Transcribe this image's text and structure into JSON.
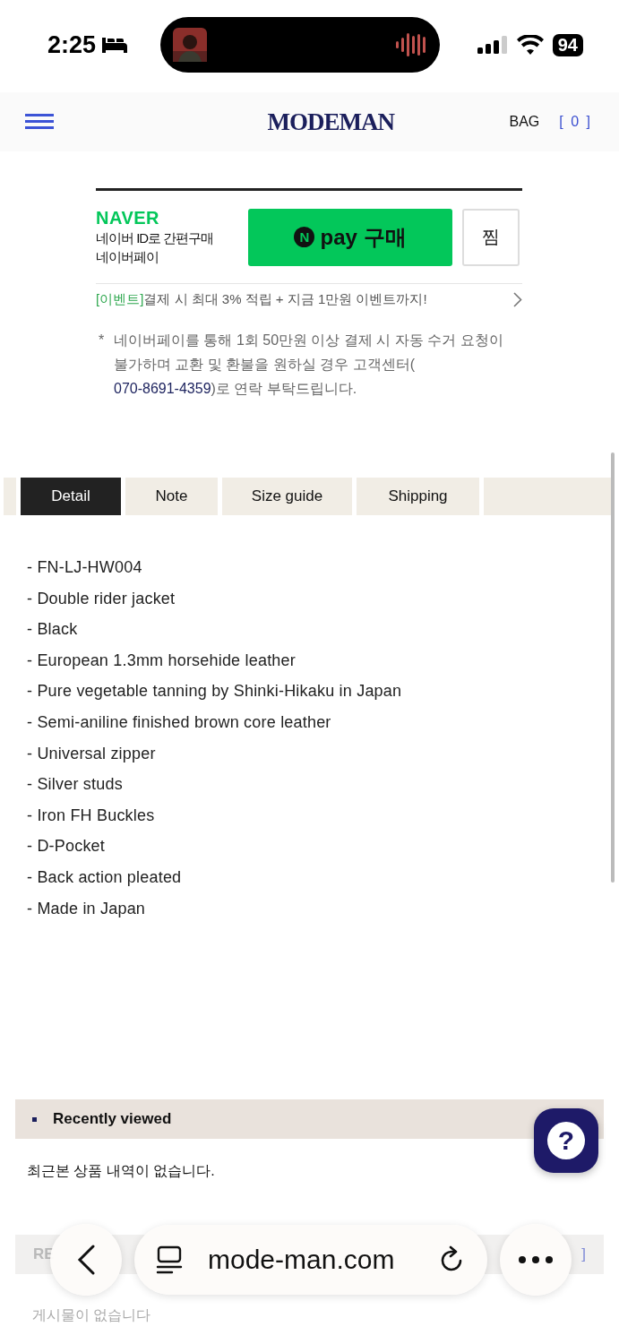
{
  "status_bar": {
    "time": "2:25",
    "battery": "94"
  },
  "header": {
    "logo": "MODEMAN",
    "bag_label": "BAG",
    "bag_count": "[ 0 ]"
  },
  "naver_pay": {
    "brand": "NAVER",
    "tagline": "네이버 ID로 간편구매",
    "subtitle": "네이버페이",
    "pay_badge": "N",
    "pay_button": "pay 구매",
    "wish_button": "찜",
    "event_tag": "[이벤트]",
    "event_text": "결제 시 최대 3% 적립 + 지금 1만원 이벤트까지!",
    "note_mark": "*",
    "note_text": "네이버페이를 통해 1회 50만원 이상 결제 시 자동 수거 요청이 불가하며 교환 및 환불을 원하실 경우 고객센터(",
    "note_phone": "070-8691-4359",
    "note_end": ")로 연락 부탁드립니다."
  },
  "tabs": [
    {
      "label": "Detail",
      "selected": true
    },
    {
      "label": "Note",
      "selected": false
    },
    {
      "label": "Size guide",
      "selected": false
    },
    {
      "label": "Shipping",
      "selected": false
    }
  ],
  "details": [
    "- FN-LJ-HW004",
    "- Double rider jacket",
    "- Black",
    "- European 1.3mm horsehide leather",
    "- Pure vegetable tanning by Shinki-Hikaku in Japan",
    "- Semi-aniline finished brown core leather",
    "- Universal zipper",
    "- Silver studs",
    "- Iron FH Buckles",
    "- D-Pocket",
    "- Back action pleated",
    "- Made in Japan"
  ],
  "recently_viewed": {
    "title": "Recently viewed",
    "empty_text": "최근본 상품 내역이 없습니다."
  },
  "help_button": "?",
  "review": {
    "title": "RE",
    "bracket": "]",
    "empty_text": "게시물이 없습니다"
  },
  "browser_bar": {
    "url": "mode-man.com"
  }
}
